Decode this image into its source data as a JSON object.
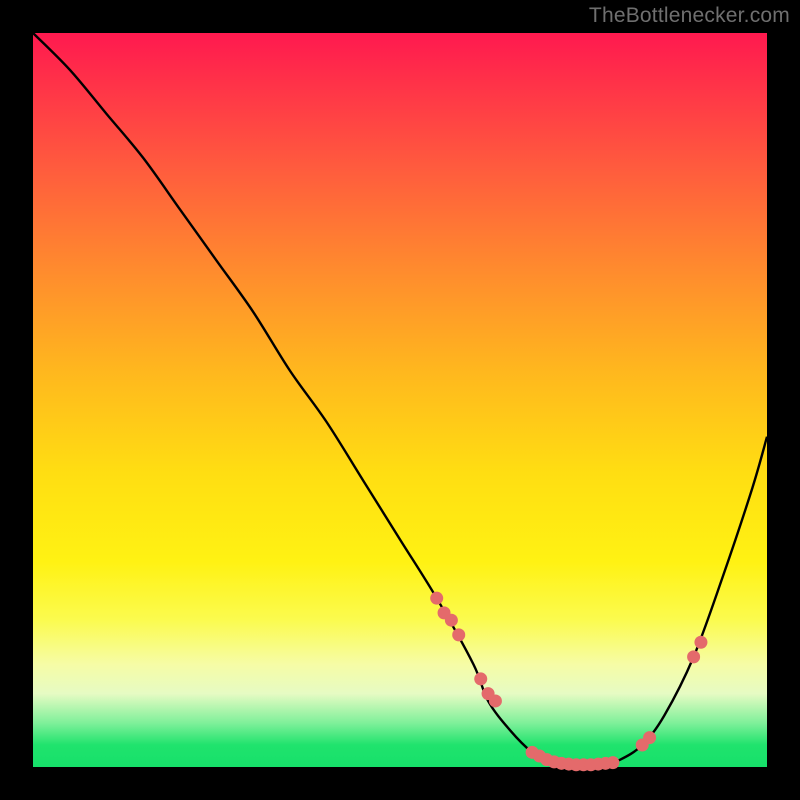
{
  "watermark": "TheBottlenecker.com",
  "chart_data": {
    "type": "line",
    "title": "",
    "xlabel": "",
    "ylabel": "",
    "xlim": [
      0,
      100
    ],
    "ylim": [
      0,
      100
    ],
    "grid": false,
    "legend": false,
    "series": [
      {
        "name": "bottleneck-curve",
        "x": [
          0,
          5,
          10,
          15,
          20,
          25,
          30,
          35,
          40,
          45,
          50,
          55,
          60,
          62,
          65,
          68,
          70,
          72,
          75,
          78,
          80,
          83,
          86,
          90,
          94,
          98,
          100
        ],
        "y": [
          100,
          95,
          89,
          83,
          76,
          69,
          62,
          54,
          47,
          39,
          31,
          23,
          14,
          9,
          5,
          2,
          1,
          0.5,
          0.3,
          0.5,
          1,
          3,
          7,
          15,
          26,
          38,
          45
        ]
      }
    ],
    "markers": {
      "name": "highlighted-points",
      "x": [
        55,
        56,
        57,
        58,
        61,
        62,
        63,
        68,
        69,
        70,
        71,
        72,
        73,
        74,
        75,
        76,
        77,
        78,
        79,
        83,
        84,
        90,
        91
      ],
      "y": [
        23,
        21,
        20,
        18,
        12,
        10,
        9,
        2,
        1.5,
        1,
        0.7,
        0.5,
        0.4,
        0.3,
        0.3,
        0.3,
        0.4,
        0.5,
        0.6,
        3,
        4,
        15,
        17
      ]
    },
    "background_gradient": {
      "top": "#ff194f",
      "mid": "#ffde12",
      "bottom": "#16e06a"
    }
  }
}
